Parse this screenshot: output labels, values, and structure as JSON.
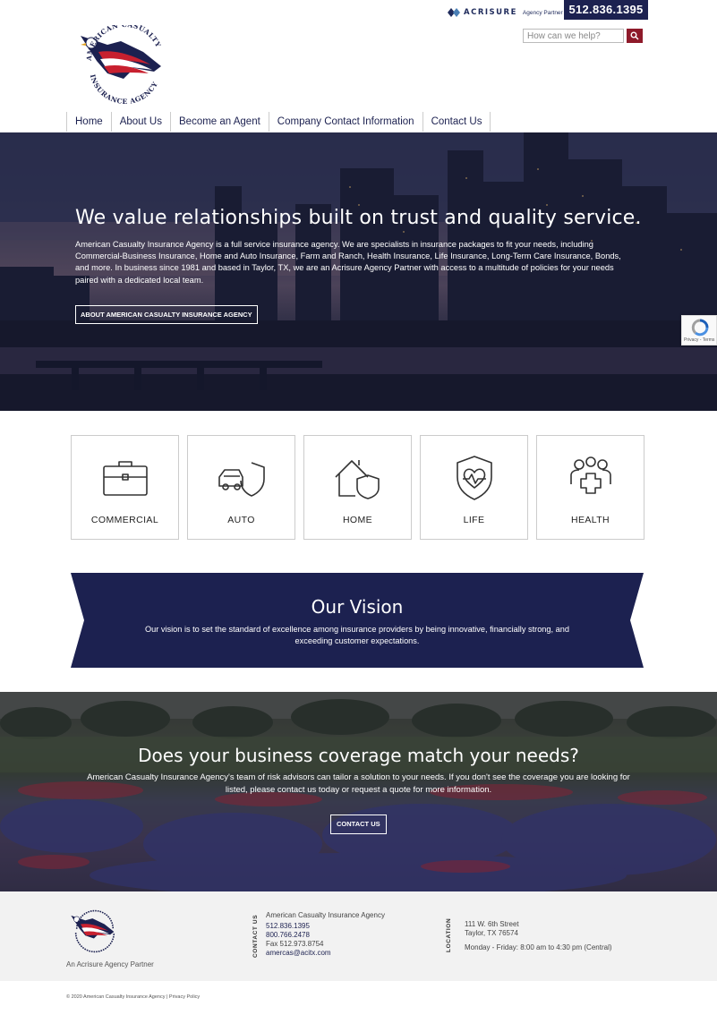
{
  "header": {
    "acrisure_brand": "ACRISURE",
    "acrisure_partner": "Agency Partner",
    "phone": "512.836.1395",
    "search_placeholder": "How can we help?",
    "logo_text_top": "AMERICAN CASUALTY",
    "logo_text_bottom": "INSURANCE AGENCY"
  },
  "nav": {
    "items": [
      "Home",
      "About Us",
      "Become an Agent",
      "Company Contact Information",
      "Contact Us"
    ]
  },
  "hero": {
    "title": "We value relationships built on trust and quality service.",
    "text": "American Casualty Insurance Agency is a full service insurance agency. We are specialists in insurance packages to fit your needs, including Commercial-Business Insurance, Home and Auto Insurance, Farm and Ranch, Health Insurance, Life Insurance, Long-Term Care Insurance, Bonds, and more. In business since 1981 and based in Taylor, TX, we are an Acrisure Agency Partner with access to a multitude of policies for your needs paired with a dedicated local team.",
    "button": "ABOUT AMERICAN CASUALTY INSURANCE AGENCY"
  },
  "recaptcha": {
    "text": "Privacy - Terms"
  },
  "services": [
    {
      "label": "COMMERCIAL",
      "icon": "briefcase-icon"
    },
    {
      "label": "AUTO",
      "icon": "car-shield-icon"
    },
    {
      "label": "HOME",
      "icon": "house-shield-icon"
    },
    {
      "label": "LIFE",
      "icon": "heart-shield-icon"
    },
    {
      "label": "HEALTH",
      "icon": "people-medical-icon"
    }
  ],
  "vision": {
    "title": "Our Vision",
    "text": "Our vision is to set the standard of excellence among insurance providers by being innovative, financially strong, and exceeding customer expectations."
  },
  "coverage": {
    "title": "Does your business coverage match your needs?",
    "text": "American Casualty Insurance Agency's team of risk advisors can tailor a solution to your needs. If you don't see the coverage you are looking for listed, please contact us today or request a quote for more information.",
    "button": "CONTACT US"
  },
  "footer": {
    "partner": "An Acrisure Agency Partner",
    "contact_label": "CONTACT US",
    "company": "American Casualty Insurance Agency",
    "phone1": "512.836.1395",
    "phone2": "800.766.2478",
    "fax": "Fax 512.973.8754",
    "email": "amercas@acitx.com",
    "location_label": "LOCATION",
    "address1": "111 W. 6th Street",
    "address2": "Taylor, TX 76574",
    "hours": "Monday - Friday: 8:00 am to 4:30 pm (Central)"
  },
  "bottom": {
    "text": "© 2020 American Casualty Insurance Agency | Privacy Policy"
  },
  "colors": {
    "navy": "#1c2150",
    "red": "#8e1a2a",
    "footer_bg": "#f2f2f2"
  }
}
